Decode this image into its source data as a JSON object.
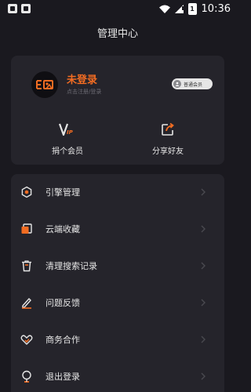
{
  "status_bar": {
    "time": "10:36",
    "battery_level": "1"
  },
  "header": {
    "title": "管理中心"
  },
  "profile": {
    "login_title": "未登录",
    "login_subtitle": "点击注册/登录",
    "member_badge": "普通会员"
  },
  "actions": [
    {
      "label": "捐个会员",
      "icon": "vip-icon"
    },
    {
      "label": "分享好友",
      "icon": "share-icon"
    }
  ],
  "menu": [
    {
      "label": "引擎管理",
      "icon": "engine-icon"
    },
    {
      "label": "云端收藏",
      "icon": "cloud-favorites-icon"
    },
    {
      "label": "清理搜索记录",
      "icon": "trash-icon"
    },
    {
      "label": "问题反馈",
      "icon": "edit-icon"
    },
    {
      "label": "商务合作",
      "icon": "handshake-icon"
    },
    {
      "label": "退出登录",
      "icon": "logout-icon"
    }
  ],
  "colors": {
    "background": "#1a191f",
    "card": "#25242b",
    "accent": "#f26c22",
    "text": "#e6e6e6"
  }
}
